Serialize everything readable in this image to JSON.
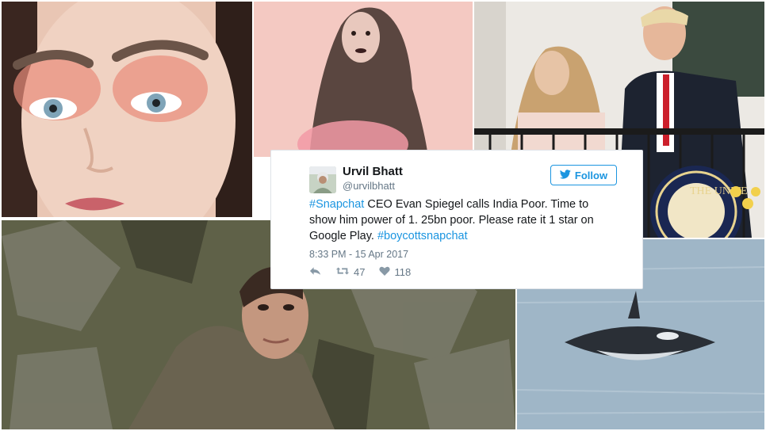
{
  "tweet": {
    "author_name": "Urvil Bhatt",
    "author_handle": "@urvilbhatt",
    "follow_label": "Follow",
    "text_parts": {
      "hashtag1": "#Snapchat",
      "body": " CEO Evan Spiegel calls India Poor. Time to show him power of 1. 25bn poor. Please rate it 1 star on Google Play. ",
      "hashtag2": "#boycottsnapchat"
    },
    "timestamp": "8:33 PM - 15 Apr 2017",
    "retweet_count": "47",
    "like_count": "118",
    "icons": {
      "reply": "reply-icon",
      "retweet": "retweet-icon",
      "like": "heart-icon",
      "follow": "twitter-bird-icon"
    },
    "colors": {
      "link": "#1b95e0",
      "text": "#14171a",
      "muted": "#657786"
    }
  },
  "seal_text": "THE UNITE"
}
